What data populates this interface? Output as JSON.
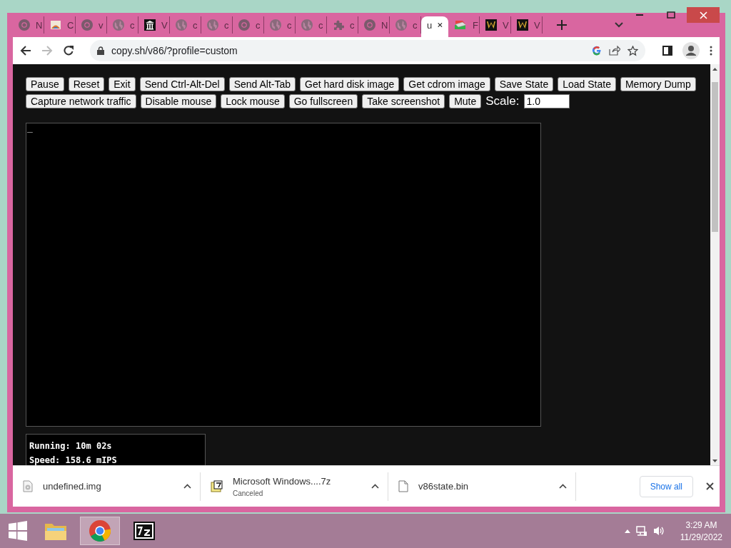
{
  "browser": {
    "tabs": [
      {
        "kind": "chrome",
        "label": "N",
        "selected": false
      },
      {
        "kind": "picture",
        "label": "C",
        "selected": false
      },
      {
        "kind": "chrome",
        "label": "v",
        "selected": false
      },
      {
        "kind": "globe",
        "label": "c",
        "selected": false
      },
      {
        "kind": "museum",
        "label": "V",
        "selected": false
      },
      {
        "kind": "globe",
        "label": "c",
        "selected": false
      },
      {
        "kind": "globe",
        "label": "c",
        "selected": false
      },
      {
        "kind": "chrome",
        "label": "c",
        "selected": false
      },
      {
        "kind": "globe",
        "label": "c",
        "selected": false
      },
      {
        "kind": "globe",
        "label": "c",
        "selected": false
      },
      {
        "kind": "puzzle",
        "label": "c",
        "selected": false
      },
      {
        "kind": "chrome",
        "label": "N",
        "selected": false
      },
      {
        "kind": "globe",
        "label": "c",
        "selected": false
      },
      {
        "kind": "plain",
        "label": "u",
        "selected": true
      },
      {
        "kind": "drive",
        "label": "F",
        "selected": false
      },
      {
        "kind": "w",
        "label": "V",
        "selected": false
      },
      {
        "kind": "w",
        "label": "V",
        "selected": false
      }
    ],
    "address": "copy.sh/v86/?profile=custom"
  },
  "page": {
    "buttons": [
      [
        "Pause",
        "Reset",
        "Exit",
        "Send Ctrl-Alt-Del",
        "Send Alt-Tab",
        "Get hard disk image",
        "Get cdrom image",
        "Save State",
        "Load State",
        "Memory Dump"
      ],
      [
        "Capture network traffic",
        "Disable mouse",
        "Lock mouse",
        "Go fullscreen",
        "Take screenshot",
        "Mute"
      ]
    ],
    "scale_label": "Scale:",
    "scale_value": "1.0",
    "screen_cursor": "_",
    "stats": [
      "Running: 10m 02s",
      "Speed: 158.6 mIPS"
    ]
  },
  "downloads": {
    "items": [
      {
        "kind": "disk",
        "name": "undefined.img"
      },
      {
        "kind": "archive",
        "name": "Microsoft Windows....7z",
        "status": "Canceled"
      },
      {
        "kind": "file",
        "name": "v86state.bin"
      }
    ],
    "show_all": "Show all"
  },
  "taskbar": {
    "apps": [
      {
        "kind": "folder",
        "selected": false
      },
      {
        "kind": "chrome",
        "selected": true
      },
      {
        "kind": "sevenzip",
        "selected": false
      }
    ],
    "time": "3:29 AM",
    "date": "11/29/2022"
  }
}
